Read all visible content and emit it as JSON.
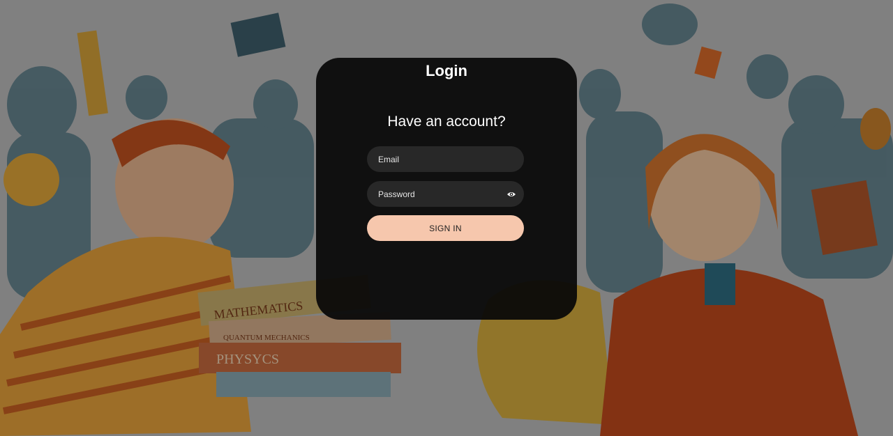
{
  "login": {
    "title": "Login",
    "subtitle": "Have an account?",
    "email_placeholder": "Email",
    "password_placeholder": "Password",
    "signin_label": "SIGN IN"
  },
  "icons": {
    "password_toggle": "eye-icon"
  },
  "colors": {
    "card_background": "#080808",
    "signin_button": "#f6c7ad",
    "backdrop_orange": "#c8501e",
    "backdrop_yellow": "#e8b440",
    "backdrop_teal": "#3f6c7a"
  },
  "backdrop": {
    "book_spines": [
      "MATHEMATICS",
      "QUANTUM MECHANICS",
      "PHYSYCS"
    ]
  }
}
